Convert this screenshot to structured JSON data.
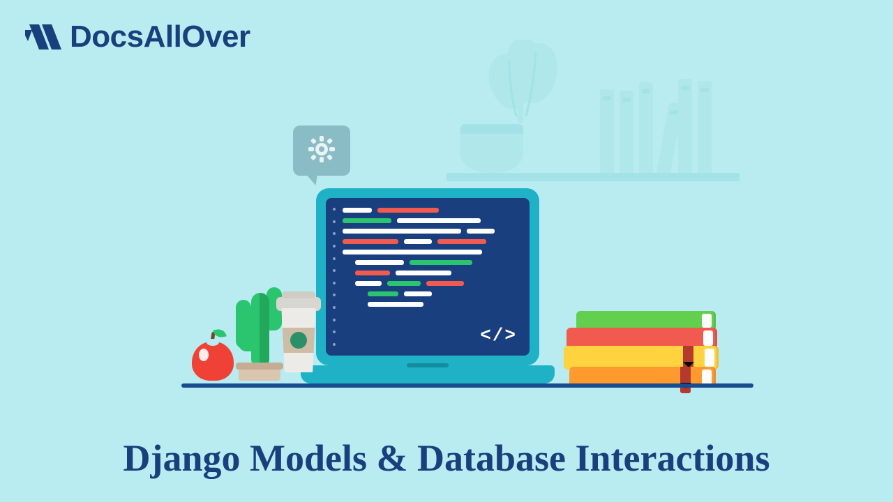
{
  "brand": {
    "name": "DocsAllOver"
  },
  "title": "Django Models & Database Interactions",
  "laptop": {
    "code_tag": "</>"
  },
  "colors": {
    "background": "#b8ecf1",
    "brand_text": "#17407c",
    "screen_bg": "#1a3f7e",
    "laptop_frame": "#1fb2c6",
    "code_white": "#ffffff",
    "code_red": "#f05a4f",
    "code_green": "#2cc56f",
    "apple": "#ef4136",
    "cactus": "#2cc56f",
    "book_green": "#62d04e",
    "book_red": "#f05a4f",
    "book_yellow": "#ffd23f",
    "book_orange": "#ff9a2e"
  },
  "icons": {
    "logo": "docsallover-logo-icon",
    "gear": "gear-icon"
  }
}
